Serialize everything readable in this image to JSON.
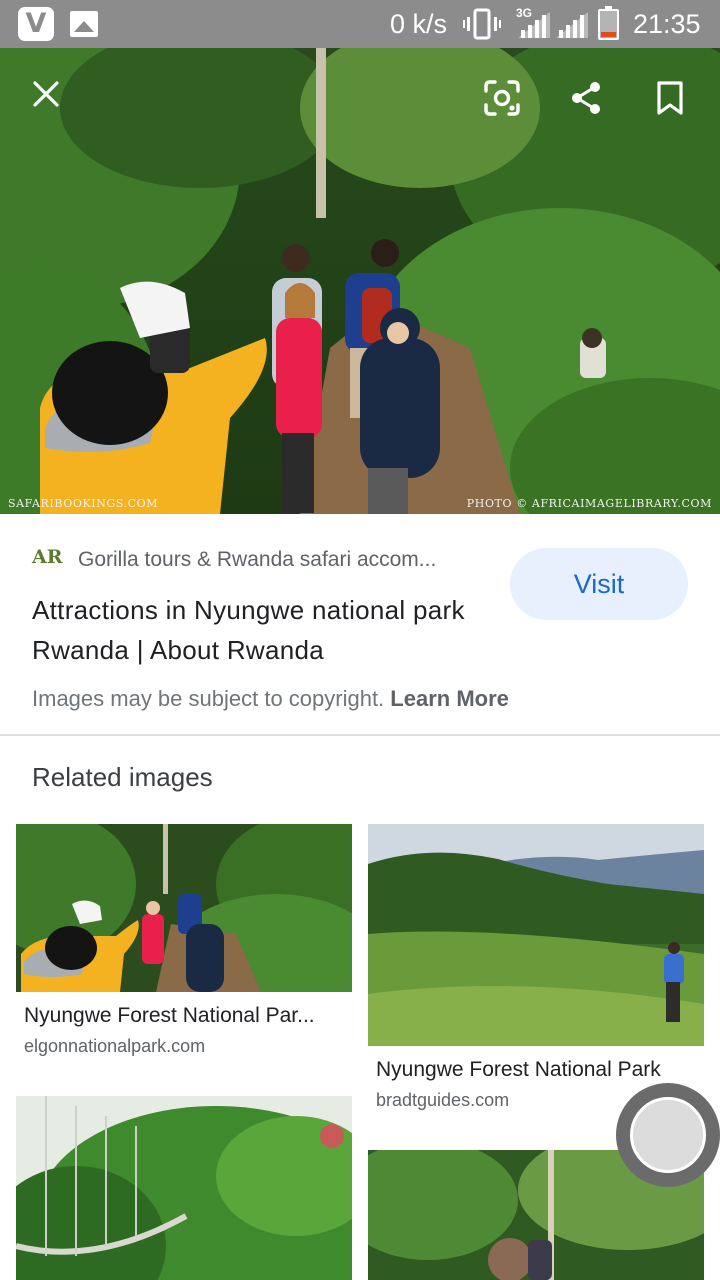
{
  "status_bar": {
    "app_icon": "v-app-icon",
    "notification_icon": "gallery-icon",
    "speed": "0 k/s",
    "network": "3G",
    "time": "21:35",
    "battery_color": "#e64a19"
  },
  "viewer": {
    "close_icon": "close-icon",
    "lens_icon": "google-lens-icon",
    "share_icon": "share-icon",
    "bookmark_icon": "bookmark-icon",
    "credit_left": "SafariBookings.com",
    "credit_right": "Photo © AfricaImageLibrary.com"
  },
  "result": {
    "source_logo": "AR",
    "source_name": "Gorilla tours & Rwanda safari accom...",
    "title": "Attractions in Nyungwe national park Rwanda | About Rwanda",
    "visit_label": "Visit",
    "copyright_text": "Images may be subject to copyright.",
    "learn_more_label": "Learn More"
  },
  "related": {
    "heading": "Related images",
    "items": [
      {
        "caption": "Nyungwe Forest National Par...",
        "domain": "elgonnationalpark.com"
      },
      {
        "caption": "Nyungwe Forest National Park",
        "domain": "bradtguides.com"
      },
      {
        "caption": "",
        "domain": ""
      },
      {
        "caption": "",
        "domain": ""
      }
    ]
  },
  "colors": {
    "status_bar": "#8c8c8c",
    "visit_bg": "#e8f0fe",
    "visit_text": "#1967d2"
  }
}
